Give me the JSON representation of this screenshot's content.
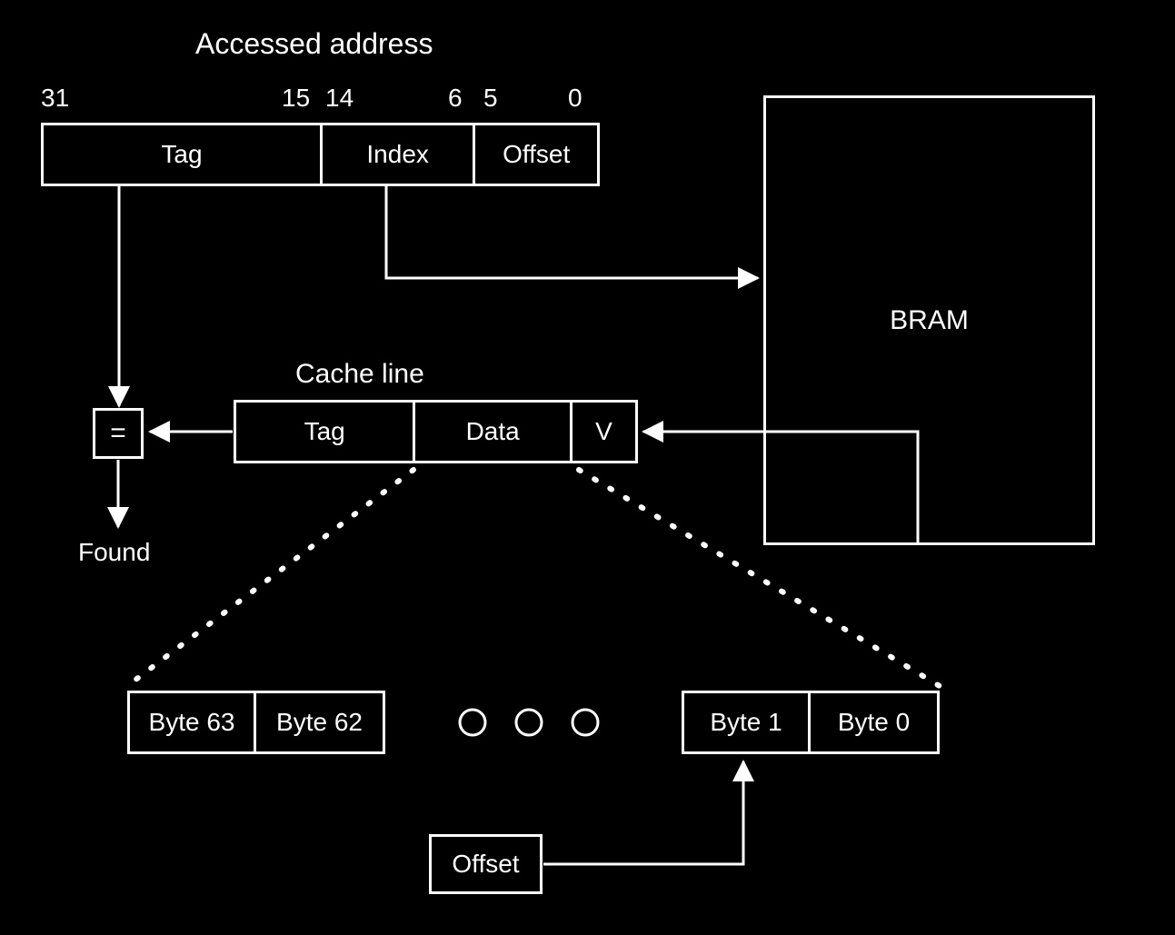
{
  "titles": {
    "accessed_address": "Accessed address",
    "cache_line": "Cache line"
  },
  "bit_positions": {
    "p31": "31",
    "p15": "15",
    "p14": "14",
    "p6": "6",
    "p5": "5",
    "p0": "0"
  },
  "address_fields": {
    "tag": "Tag",
    "index": "Index",
    "offset": "Offset"
  },
  "bram": "BRAM",
  "comparator": "=",
  "found": "Found",
  "cache_line_fields": {
    "tag": "Tag",
    "data": "Data",
    "v": "V"
  },
  "bytes": {
    "b63": "Byte 63",
    "b62": "Byte 62",
    "b1": "Byte 1",
    "b0": "Byte 0"
  },
  "offset_box": "Offset"
}
